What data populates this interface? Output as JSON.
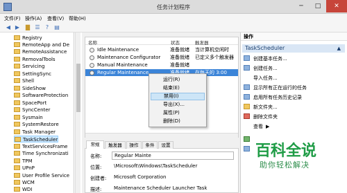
{
  "window": {
    "title": "任务计划程序"
  },
  "menu": [
    "文件(F)",
    "操作(A)",
    "查看(V)",
    "帮助(H)"
  ],
  "tree": [
    "Registry",
    "RemoteApp and De",
    "RemoteAssistance",
    "RemovalTools",
    "Servicing",
    "SettingSync",
    "Shell",
    "SideShow",
    "SoftwareProtection",
    "SpacePort",
    "SyncCenter",
    "Sysmain",
    "SystemRestore",
    "Task Manager",
    "TaskScheduler",
    "TextServicesFrame",
    "Time Synchronizati",
    "TPM",
    "UPnP",
    "User Profile Service",
    "WCM",
    "WDI"
  ],
  "task_list": {
    "headers": [
      "名称",
      "状态",
      "触发器"
    ],
    "rows": [
      {
        "name": "Idle Maintenance",
        "status": "准备就绪",
        "trigger": "当计算机空闲时"
      },
      {
        "name": "Maintenance Configurator",
        "status": "准备就绪",
        "trigger": "已定义多个触发器"
      },
      {
        "name": "Manual Maintenance",
        "status": "准备就绪",
        "trigger": ""
      },
      {
        "name": "Regular Maintenance",
        "status": "准备就绪",
        "trigger": "在每天的 3:00"
      }
    ]
  },
  "context_menu": [
    "运行(R)",
    "结束(E)",
    "禁用(I)",
    "导出(X)...",
    "属性(P)",
    "删除(D)"
  ],
  "detail_tabs": [
    "常规",
    "触发器",
    "操作",
    "条件",
    "设置"
  ],
  "details": {
    "name_label": "名称:",
    "name_value": "Regular Mainte",
    "location_label": "位置:",
    "location_value": "\\Microsoft\\Windows\\TaskScheduler",
    "author_label": "创建者:",
    "author_value": "Microsoft Corporation",
    "desc_label": "描述:",
    "desc_value": "Maintenance Scheduler Launcher Task"
  },
  "actions": {
    "header": "操作",
    "section": "TaskScheduler",
    "items": [
      "创建基本任务...",
      "创建任务...",
      "导入任务...",
      "显示所有正在运行的任务",
      "启用所有任务历史记录",
      "新文件夹...",
      "删除文件夹",
      "查看"
    ]
  },
  "watermark": {
    "main": "百科全说",
    "sub": "助你轻松解决"
  }
}
